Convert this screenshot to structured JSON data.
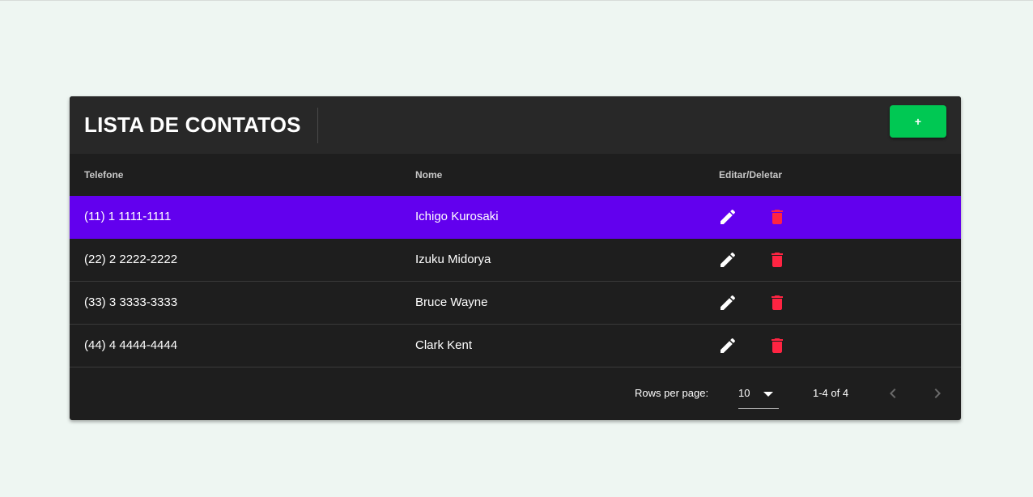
{
  "header": {
    "title": "LISTA DE CONTATOS",
    "add_label": "+"
  },
  "table": {
    "columns": [
      "Telefone",
      "Nome",
      "Editar/Deletar"
    ],
    "rows": [
      {
        "phone": "(11) 1 1111-1111",
        "name": "Ichigo Kurosaki",
        "selected": true
      },
      {
        "phone": "(22) 2 2222-2222",
        "name": "Izuku Midorya",
        "selected": false
      },
      {
        "phone": "(33) 3 3333-3333",
        "name": "Bruce Wayne",
        "selected": false
      },
      {
        "phone": "(44) 4 4444-4444",
        "name": "Clark Kent",
        "selected": false
      }
    ],
    "row_icons": {
      "edit": "pencil-icon",
      "delete": "trash-icon"
    }
  },
  "pagination": {
    "rows_per_page_label": "Rows per page:",
    "rows_per_page_value": "10",
    "range_label": "1-4 of 4"
  },
  "colors": {
    "page_background": "#eef6f2",
    "card_background": "#1e1e1e",
    "header_background": "#282828",
    "selected_row": "#6200ee",
    "add_button": "#00c853",
    "delete_icon": "#ff2442"
  }
}
